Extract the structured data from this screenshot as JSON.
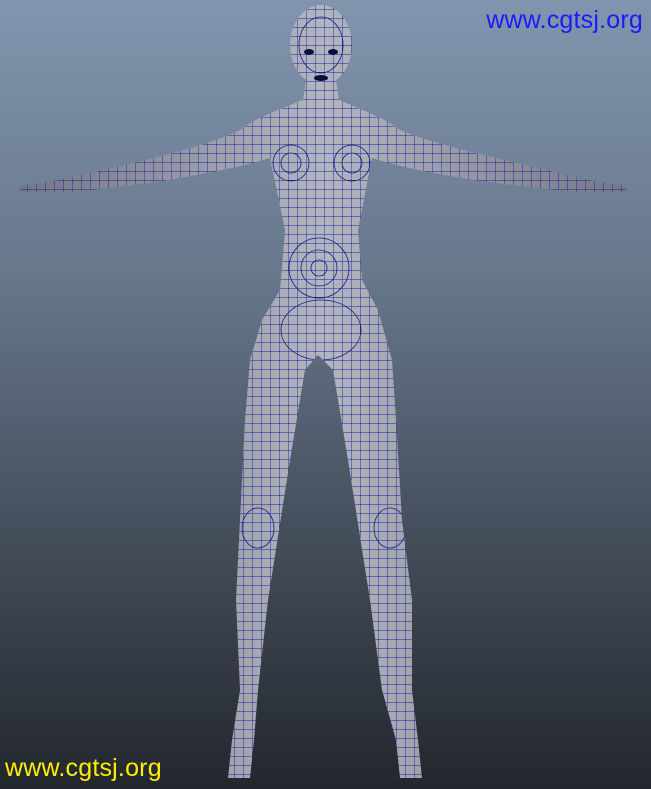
{
  "viewport": {
    "background_top": "#8195ae",
    "background_bottom": "#22272d"
  },
  "model": {
    "subject": "wireframe mesh",
    "surface_color": "#9c9fa8",
    "wire_color": "#1a1f9e"
  },
  "watermarks": {
    "top_right": {
      "text": "www.cgtsj.org",
      "color": "#1a1aff"
    },
    "bottom_left": {
      "text": "www.cgtsj.org",
      "color": "#ffee00"
    }
  }
}
